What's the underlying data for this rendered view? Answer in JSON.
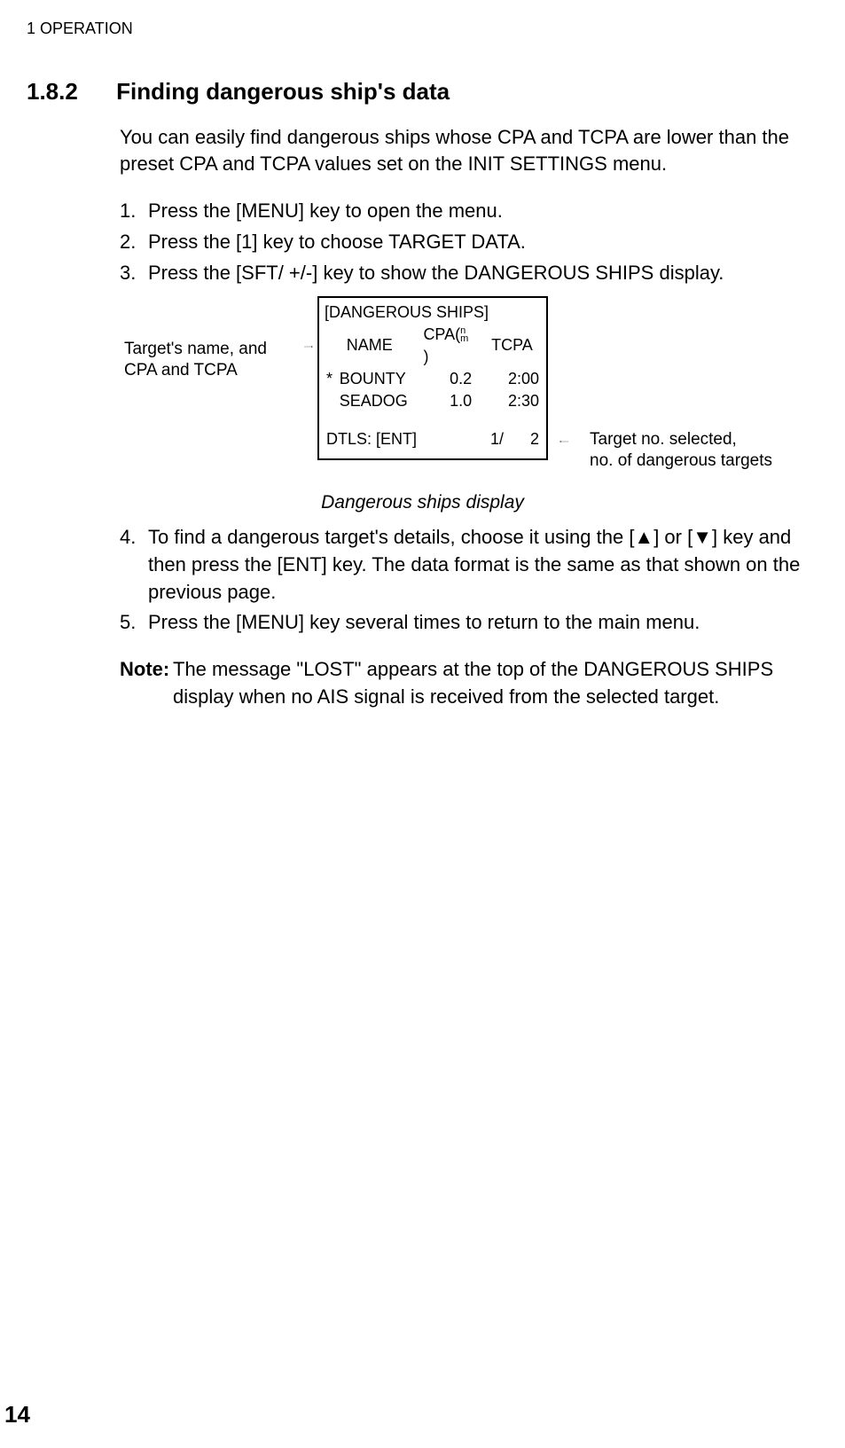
{
  "header": {
    "chapter": "1    OPERATION"
  },
  "section": {
    "number": "1.8.2",
    "title": "Finding dangerous ship's data"
  },
  "intro": "You can easily find dangerous ships whose CPA and TCPA are lower than the preset CPA and TCPA values set on the INIT SETTINGS menu.",
  "steps": {
    "s1_num": "1.",
    "s1_text": "Press the [MENU] key to open the menu.",
    "s2_num": "2.",
    "s2_text": "Press the [1] key to choose TARGET DATA.",
    "s3_num": "3.",
    "s3_text": "Press the [SFT/ +/-] key to show the DANGEROUS SHIPS display.",
    "s4_num": "4.",
    "s4_text": "To find a dangerous target's details, choose it using the [▲] or [▼] key and then press the [ENT] key. The data format is the same as that shown on the previous page.",
    "s5_num": "5.",
    "s5_text": "Press the [MENU] key several times to return to the main menu."
  },
  "screen": {
    "title": "[DANGEROUS SHIPS]",
    "col_name": "NAME",
    "col_cpa_pre": "CPA(",
    "col_cpa_post": ")",
    "unit_n": "n",
    "unit_m": "m",
    "col_tcpa": "TCPA",
    "rows": {
      "r0_star": "*",
      "r0_name": "BOUNTY",
      "r0_cpa": "0.2",
      "r0_tcpa": "2:00",
      "r1_star": "",
      "r1_name": "SEADOG",
      "r1_cpa": "1.0",
      "r1_tcpa": "2:30"
    },
    "footer_label": "DTLS: [ENT]",
    "footer_page": "1/",
    "footer_total": "2"
  },
  "callouts": {
    "left_l1": "Target's name, and",
    "left_l2": "CPA and TCPA",
    "right_l1": "Target no. selected,",
    "right_l2": "no. of dangerous targets"
  },
  "caption": "Dangerous ships display",
  "note": {
    "label": "Note:",
    "text": "The message \"LOST\" appears at the top of the DANGEROUS SHIPS display when no AIS signal is received from the selected target."
  },
  "page_number": "14"
}
